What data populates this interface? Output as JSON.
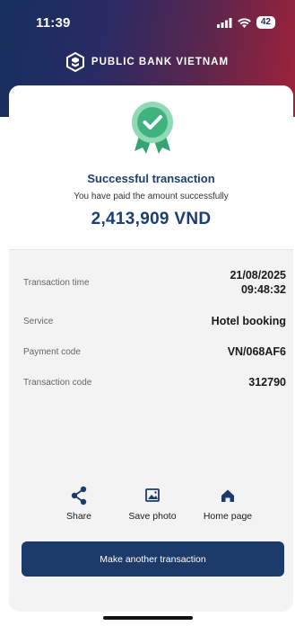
{
  "status": {
    "time": "11:39",
    "battery": "42"
  },
  "brand": {
    "name": "PUBLIC BANK VIETNAM"
  },
  "result": {
    "title": "Successful transaction",
    "description": "You have paid the amount successfully",
    "amount": "2,413,909 VND"
  },
  "details": [
    {
      "label": "Transaction time",
      "value_line1": "21/08/2025",
      "value_line2": "09:48:32"
    },
    {
      "label": "Service",
      "value": "Hotel booking"
    },
    {
      "label": "Payment code",
      "value": "VN/068AF6"
    },
    {
      "label": "Transaction code",
      "value": "312790"
    }
  ],
  "actions": {
    "share": "Share",
    "save_photo": "Save photo",
    "home_page": "Home page"
  },
  "primary_button": "Make another transaction",
  "colors": {
    "primary": "#1c3b6b",
    "success": "#3fb27f",
    "header_start": "#16305e",
    "header_end": "#a0213a"
  },
  "icons": [
    "signal-icon",
    "wifi-icon",
    "battery-icon",
    "bank-logo-icon",
    "success-badge-icon",
    "share-icon",
    "image-icon",
    "home-icon"
  ]
}
